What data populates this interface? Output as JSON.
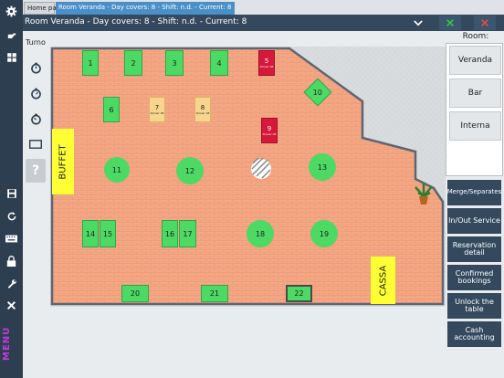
{
  "tabs": {
    "home": "Home page",
    "room": "Room Veranda - Day covers: 8 - Shift: n.d. - Current: 8"
  },
  "header": {
    "title": "Room Veranda - Day covers: 8 - Shift: n.d. - Current: 8",
    "dropdown_icon": "chevron-down-icon",
    "ok_icon": "excel-icon",
    "close_icon": "close-icon"
  },
  "sidebar": {
    "icons": [
      "gear-icon",
      "hand-icon",
      "grid-icon",
      "save-icon",
      "refresh-icon",
      "keyboard-icon",
      "lock-icon",
      "wrench-icon",
      "close-icon"
    ],
    "menu_label": "MENU"
  },
  "turno": {
    "label": "Turno"
  },
  "tools": [
    "timer-icon",
    "timer-icon",
    "timer-icon",
    "rectangle-icon",
    "help-icon"
  ],
  "tools_help_text": "?",
  "floor": {
    "buffet_label": "BUFFET",
    "cassa_label": "CASSA",
    "tables": [
      {
        "label": "1",
        "status": "free"
      },
      {
        "label": "2",
        "status": "free"
      },
      {
        "label": "3",
        "status": "free"
      },
      {
        "label": "4",
        "status": "free"
      },
      {
        "label": "5",
        "status": "reserved",
        "note": "Dinner 08"
      },
      {
        "label": "6",
        "status": "free"
      },
      {
        "label": "7",
        "status": "booked",
        "note": "Dinner 08"
      },
      {
        "label": "8",
        "status": "booked",
        "note": "Dinner 08"
      },
      {
        "label": "9",
        "status": "reserved",
        "note": "Dinner 08"
      },
      {
        "label": "10",
        "status": "free"
      },
      {
        "label": "11",
        "status": "free"
      },
      {
        "label": "12",
        "status": "free"
      },
      {
        "label": "13",
        "status": "free"
      },
      {
        "label": "14",
        "status": "free"
      },
      {
        "label": "15",
        "status": "free"
      },
      {
        "label": "16",
        "status": "free"
      },
      {
        "label": "17",
        "status": "free"
      },
      {
        "label": "18",
        "status": "free"
      },
      {
        "label": "19",
        "status": "free"
      },
      {
        "label": "20",
        "status": "free"
      },
      {
        "label": "21",
        "status": "free"
      },
      {
        "label": "22",
        "status": "selected"
      }
    ]
  },
  "room_panel": {
    "label": "Room:",
    "rooms": [
      "Veranda",
      "Bar",
      "Interna"
    ]
  },
  "actions": {
    "merge": "Merge/Separates",
    "inout": "In/Out Service",
    "reservation": "Reservation detail",
    "confirmed": "Confirmed bookings",
    "unlock": "Unlock the table",
    "cash": "Cash accounting"
  },
  "colors": {
    "sidebar": "#2c3e50",
    "header": "#34495e",
    "floor": "#f4a886",
    "table_free": "#4cd964",
    "table_booked": "#f8d58e",
    "table_reserved": "#d6193a",
    "accent_tab": "#4a90c8"
  }
}
